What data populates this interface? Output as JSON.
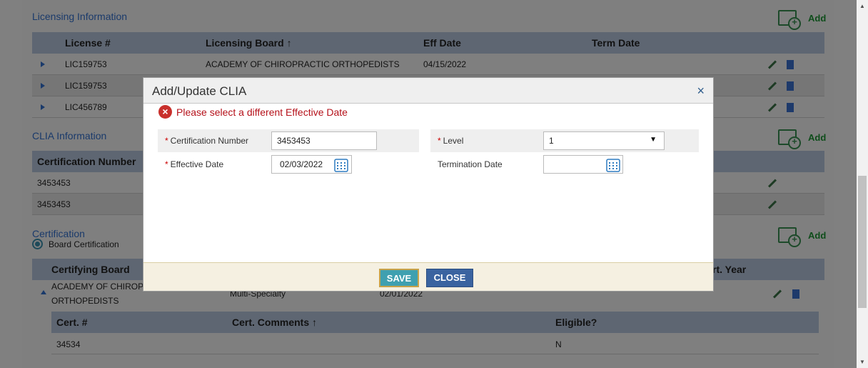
{
  "licensing": {
    "title": "Licensing Information",
    "add_label": "Add",
    "headers": [
      "License #",
      "Licensing Board",
      "Eff Date",
      "Term Date"
    ],
    "sort_arrow": "↑",
    "rows": [
      {
        "license": "LIC159753",
        "board": "ACADEMY OF CHIROPRACTIC ORTHOPEDISTS",
        "eff": "04/15/2022"
      },
      {
        "license": "LIC159753",
        "board": "",
        "eff": ""
      },
      {
        "license": "LIC456789",
        "board": "",
        "eff": ""
      }
    ]
  },
  "clia": {
    "title": "CLIA Information",
    "add_label": "Add",
    "header": "Certification Number",
    "rows": [
      "3453453",
      "3453453"
    ]
  },
  "certification": {
    "title": "Certification",
    "add_label": "Add",
    "radio_label": "Board Certification",
    "headers": [
      "Certifying Board",
      "rt. Year"
    ],
    "row": {
      "board_line1": "ACADEMY OF CHIROP",
      "board_line2": "ORTHOPEDISTS",
      "specialty": "Multi-Specialty",
      "date": "02/01/2022"
    },
    "sub_headers": [
      "Cert. #",
      "Cert. Comments",
      "Eligible?"
    ],
    "sub_row": {
      "cert": "34534",
      "eligible": "N"
    }
  },
  "modal": {
    "title": "Add/Update CLIA",
    "close_glyph": "×",
    "error": "Please select a different Effective Date",
    "fields": {
      "cert_number_label": "Certification Number",
      "cert_number_value": "3453453",
      "level_label": "Level",
      "level_value": "1",
      "effective_label": "Effective Date",
      "effective_value": "02/03/2022",
      "termination_label": "Termination Date",
      "termination_value": ""
    },
    "save_label": "SAVE",
    "close_label": "CLOSE"
  }
}
